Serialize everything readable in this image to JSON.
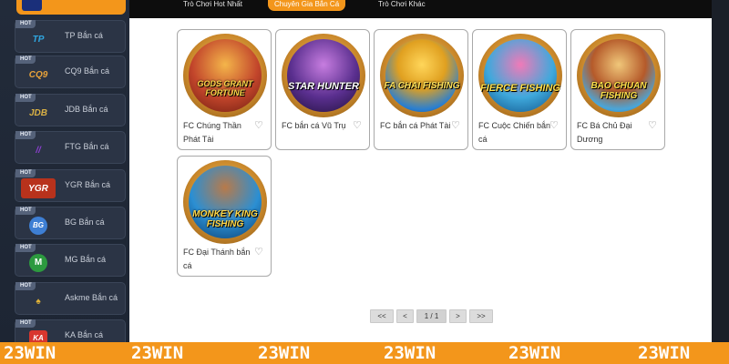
{
  "sidebar": {
    "items": [
      {
        "badge": "HOT",
        "logo": "TP",
        "logo_color": "#2fa6e0",
        "label": "TP Bắn cá"
      },
      {
        "badge": "HOT",
        "logo": "CQ9",
        "logo_color": "#e8a23a",
        "label": "CQ9 Bắn cá"
      },
      {
        "badge": "HOT",
        "logo": "JDB",
        "logo_color": "#d8b045",
        "label": "JDB Bắn cá"
      },
      {
        "badge": "HOT",
        "logo": "//",
        "logo_color": "#8c3fd1",
        "label": "FTG Bắn cá"
      },
      {
        "badge": "HOT",
        "logo": "YGR",
        "logo_color": "#e24c2c",
        "label": "YGR Bắn cá"
      },
      {
        "badge": "HOT",
        "logo": "BG",
        "logo_color": "#4a8ee0",
        "label": "BG Bắn cá"
      },
      {
        "badge": "HOT",
        "logo": "M",
        "logo_color": "#37b54a",
        "label": "MG Bắn cá"
      },
      {
        "badge": "HOT",
        "logo": "♠",
        "logo_color": "#e3b437",
        "label": "Askme Bắn cá"
      },
      {
        "badge": "HOT",
        "logo": "KA",
        "logo_color": "#e0413a",
        "label": "KA Bắn cá"
      }
    ]
  },
  "tabs": [
    {
      "label": "Trò Chơi Hot Nhất",
      "active": false
    },
    {
      "label": "Chuyên Gia Bắn Cá",
      "active": true
    },
    {
      "label": "Trò Chơi Khác",
      "active": false
    }
  ],
  "games": [
    {
      "name": "FC Chúng Thần Phát Tài",
      "art": "GODS GRANT FORTUNE",
      "bg": "#c2452b"
    },
    {
      "name": "FC bắn cá Vũ Trụ",
      "art": "STAR HUNTER",
      "bg": "#5a2f8f"
    },
    {
      "name": "FC bắn cá Phát Tài",
      "art": "FA CHAI FISHING",
      "bg": "#2a7fd0"
    },
    {
      "name": "FC Cuộc Chiến bắn cá",
      "art": "FIERCE FISHING",
      "bg": "#3fa9dc"
    },
    {
      "name": "FC Bá Chủ Đại Dương",
      "art": "BAO CHUAN FISHING",
      "bg": "#4aa6d9"
    },
    {
      "name": "FC Đại Thánh bắn cá",
      "art": "MONKEY KING FISHING",
      "bg": "#2b8fd3"
    }
  ],
  "pagination": {
    "first": "<<",
    "prev": "<",
    "page": "1 / 1",
    "next": ">",
    "last": ">>"
  },
  "brand": {
    "text": "23WIN",
    "band_color": "#f3961b"
  },
  "colors": {
    "accent": "#f3961b",
    "sidebar_bg": "#222b3a",
    "topnav_bg": "#0d0d0d"
  }
}
